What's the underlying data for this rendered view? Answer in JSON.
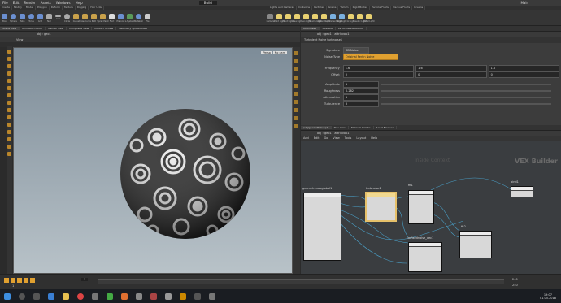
{
  "menu": [
    "File",
    "Edit",
    "Render",
    "Assets",
    "Windows",
    "Help",
    "Build",
    "Main"
  ],
  "shelf_tabs_left": [
    "Create",
    "Modify",
    "Model",
    "Polygon",
    "Deform",
    "Texture",
    "Rigging",
    "Hair Utils"
  ],
  "shelf_tabs_right": [
    "Lights and Cameras",
    "Collisions",
    "Particles",
    "Grains",
    "Vellum",
    "Rigid Bodies",
    "Particle Fluids",
    "Viscous Fluids",
    "Oceans"
  ],
  "shelf_tools_left": [
    "Box",
    "Sphere",
    "Tube",
    "Torus",
    "Grid",
    "Null",
    "Line",
    "Circle",
    "Curve",
    "Draw Curve",
    "Path",
    "Spray Paint",
    "Font",
    "Platonic",
    "L-System",
    "Metaball",
    "File"
  ],
  "shelf_tools_right": [
    "Camera",
    "Point Light",
    "Spot Light",
    "Area Light",
    "Geo Light",
    "Volume Light",
    "Distant Light",
    "Environment Light",
    "Sky Light",
    "GI Light",
    "Caustic Light",
    "Portal Light"
  ],
  "left_tabs": [
    "Scene View",
    "Animation Editor",
    "Render View",
    "Composite View",
    "Motion FX View",
    "Geometry Spreadsheet"
  ],
  "left_path": "obj › geo1",
  "viewport_label": "View",
  "viewport_persp": "Persp",
  "viewport_cam": "No cam",
  "right_tabs": [
    "turbnoise1",
    "Take List",
    "Performance Monitor"
  ],
  "right_path": "obj › geo1 › attribvop1",
  "param_header": "Turbulent Noise  turbnoise1",
  "params": [
    {
      "label": "Signature",
      "value": "3D Noise"
    },
    {
      "label": "Noise Type",
      "value": "Original Perlin Noise"
    },
    {
      "label": "Frequency",
      "value": "1.6",
      "v2": "1.6",
      "v3": "1.6"
    },
    {
      "label": "Offset",
      "value": "0",
      "v2": "0",
      "v3": "0"
    },
    {
      "label": "Amplitude",
      "value": "1"
    },
    {
      "label": "Roughness",
      "value": "0.282"
    },
    {
      "label": "Attenuation",
      "value": "1"
    },
    {
      "label": "Turbulence",
      "value": "5"
    }
  ],
  "net_tabs": [
    "/obj/geo1/attribvop1",
    "Tree View",
    "Material Palette",
    "Asset Browser"
  ],
  "net_menu": [
    "Add",
    "Edit",
    "Go",
    "View",
    "Tools",
    "Layout",
    "Help"
  ],
  "net_path": "obj › geo1 › attribvop1",
  "net_watermark_left": "Inside Context",
  "net_watermark_right": "VEX Builder",
  "nodes": [
    {
      "title": "geometryvopglobal1"
    },
    {
      "title": "turbnoise1"
    },
    {
      "title": "fit1"
    },
    {
      "title": "cmfixednoise_vec1"
    },
    {
      "title": "fit2"
    },
    {
      "title": "bind1"
    }
  ],
  "timeline": {
    "frame": "1",
    "start": "1",
    "end": "240",
    "end2": "240"
  },
  "taskbar": {
    "clock": "19:07",
    "date": "01.05.2018"
  },
  "colors": {
    "accent": "#e0a030",
    "node_selected": "#e5c06a",
    "viewport_top": "#7d8c98",
    "viewport_bottom": "#b8c2c8"
  }
}
